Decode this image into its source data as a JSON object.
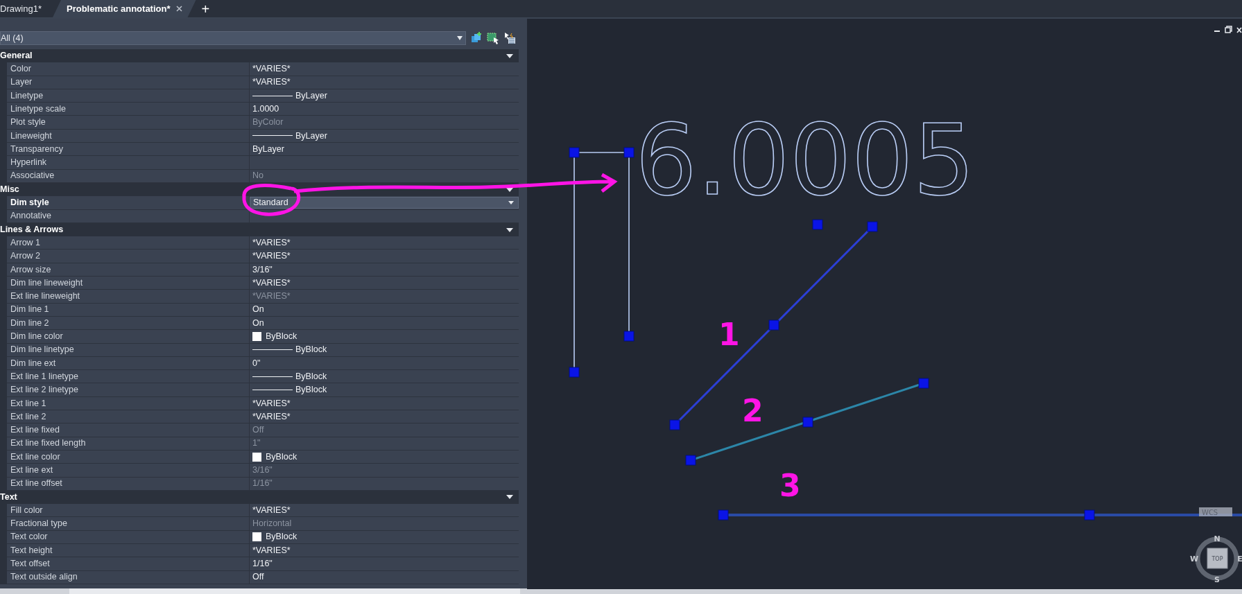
{
  "tabs": [
    {
      "label": "Drawing1*",
      "selected": false,
      "closable": false
    },
    {
      "label": "Problematic annotation*",
      "selected": true,
      "closable": true
    }
  ],
  "new_tab": "+",
  "selection": "All (4)",
  "sections": [
    {
      "title": "General",
      "expanded": true,
      "rows": [
        {
          "name": "Color",
          "value": "*VARIES*",
          "kind": "text",
          "disabled": false,
          "selected": false
        },
        {
          "name": "Layer",
          "value": "*VARIES*",
          "kind": "text",
          "disabled": false,
          "selected": false
        },
        {
          "name": "Linetype",
          "value": "ByLayer",
          "kind": "linetype",
          "disabled": false,
          "selected": false
        },
        {
          "name": "Linetype scale",
          "value": "1.0000",
          "kind": "text",
          "disabled": false,
          "selected": false
        },
        {
          "name": "Plot style",
          "value": "ByColor",
          "kind": "text",
          "disabled": true,
          "selected": false
        },
        {
          "name": "Lineweight",
          "value": "ByLayer",
          "kind": "linetype",
          "disabled": false,
          "selected": false
        },
        {
          "name": "Transparency",
          "value": "ByLayer",
          "kind": "text",
          "disabled": false,
          "selected": false
        },
        {
          "name": "Hyperlink",
          "kind": "text",
          "disabled": false,
          "selected": false
        },
        {
          "name": "Associative",
          "value": "No",
          "kind": "text",
          "disabled": true,
          "selected": false
        }
      ]
    },
    {
      "title": "Misc",
      "expanded": true,
      "rows": [
        {
          "name": "Dim style",
          "value": "Standard",
          "kind": "dropdown",
          "disabled": false,
          "selected": true
        },
        {
          "name": "Annotative",
          "kind": "text",
          "disabled": false,
          "selected": false
        }
      ]
    },
    {
      "title": "Lines & Arrows",
      "expanded": true,
      "rows": [
        {
          "name": "Arrow 1",
          "value": "*VARIES*",
          "kind": "text",
          "disabled": false,
          "selected": false
        },
        {
          "name": "Arrow 2",
          "value": "*VARIES*",
          "kind": "text",
          "disabled": false,
          "selected": false
        },
        {
          "name": "Arrow size",
          "value": "3/16\"",
          "kind": "text",
          "disabled": false,
          "selected": false
        },
        {
          "name": "Dim line lineweight",
          "value": "*VARIES*",
          "kind": "text",
          "disabled": false,
          "selected": false
        },
        {
          "name": "Ext line lineweight",
          "value": "*VARIES*",
          "kind": "text",
          "disabled": true,
          "selected": false
        },
        {
          "name": "Dim line 1",
          "value": "On",
          "kind": "text",
          "disabled": false,
          "selected": false
        },
        {
          "name": "Dim line 2",
          "value": "On",
          "kind": "text",
          "disabled": false,
          "selected": false
        },
        {
          "name": "Dim line color",
          "value": "ByBlock",
          "kind": "swatch",
          "color": "#ffffff",
          "disabled": false,
          "selected": false
        },
        {
          "name": "Dim line linetype",
          "value": "ByBlock",
          "kind": "linetype",
          "disabled": false,
          "selected": false
        },
        {
          "name": "Dim line ext",
          "value": "0\"",
          "kind": "text",
          "disabled": false,
          "selected": false
        },
        {
          "name": "Ext line 1 linetype",
          "value": "ByBlock",
          "kind": "linetype",
          "disabled": false,
          "selected": false
        },
        {
          "name": "Ext line 2 linetype",
          "value": "ByBlock",
          "kind": "linetype",
          "disabled": false,
          "selected": false
        },
        {
          "name": "Ext line 1",
          "value": "*VARIES*",
          "kind": "text",
          "disabled": false,
          "selected": false
        },
        {
          "name": "Ext line 2",
          "value": "*VARIES*",
          "kind": "text",
          "disabled": false,
          "selected": false
        },
        {
          "name": "Ext line fixed",
          "value": "Off",
          "kind": "text",
          "disabled": true,
          "selected": false
        },
        {
          "name": "Ext line fixed length",
          "value": "1\"",
          "kind": "text",
          "disabled": true,
          "selected": false
        },
        {
          "name": "Ext line color",
          "value": "ByBlock",
          "kind": "swatch",
          "color": "#ffffff",
          "disabled": false,
          "selected": false
        },
        {
          "name": "Ext line ext",
          "value": "3/16\"",
          "kind": "text",
          "disabled": true,
          "selected": false
        },
        {
          "name": "Ext line offset",
          "value": "1/16\"",
          "kind": "text",
          "disabled": true,
          "selected": false
        }
      ]
    },
    {
      "title": "Text",
      "expanded": true,
      "rows": [
        {
          "name": "Fill color",
          "value": "*VARIES*",
          "kind": "text",
          "disabled": false,
          "selected": false
        },
        {
          "name": "Fractional type",
          "value": "Horizontal",
          "kind": "text",
          "disabled": true,
          "selected": false
        },
        {
          "name": "Text color",
          "value": "ByBlock",
          "kind": "swatch",
          "color": "#ffffff",
          "disabled": false,
          "selected": false
        },
        {
          "name": "Text height",
          "value": "*VARIES*",
          "kind": "text",
          "disabled": false,
          "selected": false
        },
        {
          "name": "Text offset",
          "value": "1/16\"",
          "kind": "text",
          "disabled": false,
          "selected": false
        },
        {
          "name": "Text outside align",
          "value": "Off",
          "kind": "text",
          "disabled": false,
          "selected": false
        }
      ]
    }
  ],
  "drawing": {
    "dimension_text": "6.0005",
    "markup_numbers": [
      "1",
      "2",
      "3"
    ]
  },
  "ucs_label": "WCS",
  "viewcube": {
    "face": "TOP",
    "north": "N",
    "south": "S",
    "east": "E",
    "west": "W"
  }
}
